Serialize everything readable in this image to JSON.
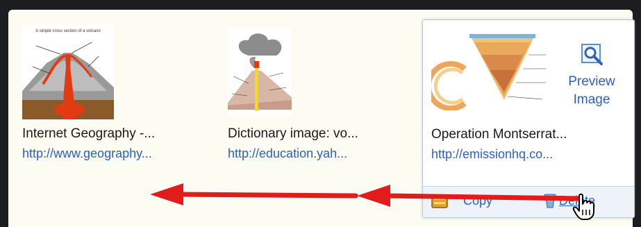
{
  "results": [
    {
      "title": "Internet Geography -...",
      "url": "http://www.geography...",
      "thumbnail": "volcano-cross-section"
    },
    {
      "title": "Dictionary image: vo...",
      "url": "http://education.yah...",
      "thumbnail": "volcano-eruption-diagram"
    },
    {
      "title": "Operation Montserrat...",
      "url": "http://emissionhq.co...",
      "thumbnail": "earth-layers-diagram"
    }
  ],
  "hover_actions": {
    "preview_line1": "Preview",
    "preview_line2": "Image",
    "copy_label": "Copy",
    "delete_label": "Delete"
  },
  "colors": {
    "link": "#2b61c0",
    "arrow": "#e21c1c",
    "background": "#fcfcf2"
  },
  "icons": [
    "magnifier-icon",
    "copy-icon",
    "trash-icon",
    "hand-cursor-icon",
    "arrow-left-icon"
  ]
}
